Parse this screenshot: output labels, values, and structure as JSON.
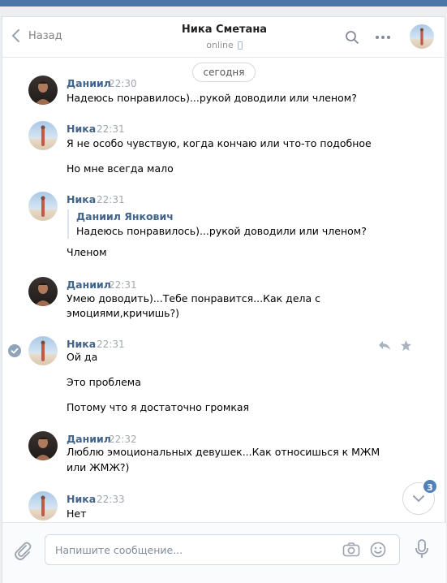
{
  "header": {
    "back_label": "Назад",
    "title": "Ника Сметана",
    "status": "online"
  },
  "date_divider": "сегодня",
  "messages": [
    {
      "author": "Даниил",
      "time": "22:30",
      "lines": [
        "Надеюсь понравилось)...рукой доводили или членом?"
      ]
    },
    {
      "author": "Ника",
      "time": "22:31",
      "lines": [
        "Я не особо чувствую, когда кончаю или что-то подобное",
        "Но мне всегда мало"
      ]
    },
    {
      "author": "Ника",
      "time": "22:31",
      "quote": {
        "author": "Даниил Янкович",
        "text": "Надеюсь понравилось)...рукой доводили или членом?"
      },
      "lines": [
        "Членом"
      ]
    },
    {
      "author": "Даниил",
      "time": "22:31",
      "lines": [
        "Умею доводить)...Тебе понравится...Как дела с",
        "эмоциями,кричишь?)"
      ]
    },
    {
      "author": "Ника",
      "time": "22:31",
      "lines": [
        "Ой да",
        "Это проблема",
        "Потому что я достаточно громкая"
      ]
    },
    {
      "author": "Даниил",
      "time": "22:32",
      "lines": [
        "Люблю эмоциональных девушек...Как относишься к МЖМ",
        "или ЖМЖ?)"
      ]
    },
    {
      "author": "Ника",
      "time": "22:33",
      "lines": [
        "Нет"
      ]
    }
  ],
  "unread_count": "3",
  "composer": {
    "placeholder": "Напишите сообщение..."
  },
  "colors": {
    "accent": "#4a76a8",
    "name_link": "#42648b",
    "badge": "#5181b8"
  },
  "icons": [
    "chevron-left-icon",
    "phone-icon",
    "search-icon",
    "more-icon",
    "reply-icon",
    "star-icon",
    "check-icon",
    "chevron-down-icon",
    "paperclip-icon",
    "camera-icon",
    "smile-icon",
    "microphone-icon"
  ]
}
